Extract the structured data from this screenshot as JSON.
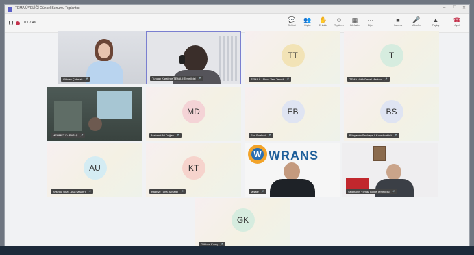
{
  "window": {
    "title": "TEMA ÜYELİĞİ Güncel Sunumu Toplantısı",
    "controls": [
      "–",
      "□",
      "✕"
    ]
  },
  "meeting": {
    "timer": "01:07:46"
  },
  "toolbar": {
    "buttons": [
      {
        "label": "Sohbet",
        "icon": "chat-icon",
        "glyph": "💬"
      },
      {
        "label": "Kişiler",
        "icon": "people-icon",
        "glyph": "👥"
      },
      {
        "label": "El kaldır",
        "icon": "raise-hand-icon",
        "glyph": "✋"
      },
      {
        "label": "Tepki ver",
        "icon": "react-icon",
        "glyph": "☺"
      },
      {
        "label": "Görünüm",
        "icon": "view-icon",
        "glyph": "▦"
      },
      {
        "label": "Diğer",
        "icon": "more-icon",
        "glyph": "⋯"
      },
      {
        "label": "Kamera",
        "icon": "camera-icon",
        "glyph": "■"
      },
      {
        "label": "Mikrofon",
        "icon": "mic-icon",
        "glyph": "🎤"
      },
      {
        "label": "Paylaş",
        "icon": "share-icon",
        "glyph": "▲"
      }
    ],
    "leave": {
      "label": "Ayrıl",
      "icon": "leave-icon",
      "glyph": "☎"
    }
  },
  "participants": [
    {
      "name": "Gülsen Çakmak",
      "type": "video",
      "scene": "woman"
    },
    {
      "name": "Tuncay Karatepe TEMA İl Temsilcisi",
      "type": "video",
      "scene": "headphones",
      "highlight": true
    },
    {
      "name": "TEMA İl - Alaca Yeni Temsil",
      "type": "avatar",
      "initials": "TT",
      "color": "#f2e3b6"
    },
    {
      "name": "TEMA Vakfı Genel Merkezi",
      "type": "avatar",
      "initials": "T",
      "color": "#d6ecdf"
    },
    {
      "name": "MEHMET KARATAŞ",
      "type": "video",
      "scene": "office"
    },
    {
      "name": "Mehmet Ali Doğan",
      "type": "avatar",
      "initials": "MD",
      "color": "#f4d3d6"
    },
    {
      "name": "Erol Bozkurt",
      "type": "avatar",
      "initials": "EB",
      "color": "#dfe4f2"
    },
    {
      "name": "Bünyamin Sarıkaya İl Koordinatörü",
      "type": "avatar",
      "initials": "BS",
      "color": "#dfe4f2"
    },
    {
      "name": "Ayşegül Ünal - AÜ (Misafir)",
      "type": "avatar",
      "initials": "AU",
      "color": "#d4ecf3"
    },
    {
      "name": "Kadriye Tuna (Misafir)",
      "type": "avatar",
      "initials": "KT",
      "color": "#f6d3cc"
    },
    {
      "name": "Misafir",
      "type": "video",
      "scene": "wrans",
      "banner": "WRANS"
    },
    {
      "name": "Selahattin Yılmaz Bölge Temsilcisi",
      "type": "video",
      "scene": "flag"
    },
    {
      "name": "Gökhan Kılınç",
      "type": "avatar",
      "initials": "GK",
      "color": "#d6ecdf"
    }
  ]
}
